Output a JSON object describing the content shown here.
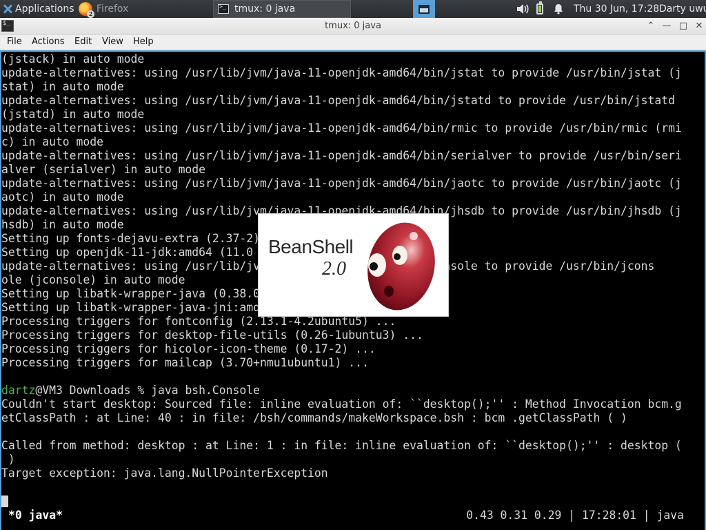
{
  "taskbar": {
    "apps_label": "Applications",
    "firefox_label": "Firefox",
    "firefox_badge": "2",
    "tmux_label": "tmux: 0 java",
    "clock": "Thu 30 Jun, 17:28",
    "user": "Darty uwu"
  },
  "window": {
    "title": "tmux: 0 java"
  },
  "menu": {
    "file": "File",
    "actions": "Actions",
    "edit": "Edit",
    "view": "View",
    "help": "Help"
  },
  "terminal": {
    "lines": [
      "(jstack) in auto mode",
      "update-alternatives: using /usr/lib/jvm/java-11-openjdk-amd64/bin/jstat to provide /usr/bin/jstat (j",
      "stat) in auto mode",
      "update-alternatives: using /usr/lib/jvm/java-11-openjdk-amd64/bin/jstatd to provide /usr/bin/jstatd",
      "(jstatd) in auto mode",
      "update-alternatives: using /usr/lib/jvm/java-11-openjdk-amd64/bin/rmic to provide /usr/bin/rmic (rmi",
      "c) in auto mode",
      "update-alternatives: using /usr/lib/jvm/java-11-openjdk-amd64/bin/serialver to provide /usr/bin/seri",
      "alver (serialver) in auto mode",
      "update-alternatives: using /usr/lib/jvm/java-11-openjdk-amd64/bin/jaotc to provide /usr/bin/jaotc (j",
      "aotc) in auto mode",
      "update-alternatives: using /usr/lib/jvm/java-11-openjdk-amd64/bin/jhsdb to provide /usr/bin/jhsdb (j",
      "hsdb) in auto mode",
      "Setting up fonts-dejavu-extra (2.37-2)",
      "Setting up openjdk-11-jdk:amd64 (11.0",
      "update-alternatives: using /usr/lib/jv                       /jconsole to provide /usr/bin/jcons",
      "ole (jconsole) in auto mode",
      "Setting up libatk-wrapper-java (0.38.0",
      "Setting up libatk-wrapper-java-jni:amd",
      "Processing triggers for fontconfig (2.13.1-4.2ubuntu5) ...",
      "Processing triggers for desktop-file-utils (0.26-1ubuntu3) ...",
      "Processing triggers for hicolor-icon-theme (0.17-2) ...",
      "Processing triggers for mailcap (3.70+nmu1ubuntu1) ...",
      "",
      "",
      "Couldn't start desktop: Sourced file: inline evaluation of: ``desktop();'' : Method Invocation bcm.g",
      "etClassPath : at Line: 40 : in file: /bsh/commands/makeWorkspace.bsh : bcm .getClassPath ( )",
      "",
      "Called from method: desktop : at Line: 1 : in file: inline evaluation of: ``desktop();'' : desktop (",
      " )",
      "Target exception: java.lang.NullPointerException",
      ""
    ],
    "prompt_user": "dartz",
    "prompt_rest": "@VM3 Downloads % java bsh.Console",
    "status_left": "*0 java*",
    "status_right": "0.43 0.31 0.29 | 17:28:01 | java"
  },
  "splash": {
    "title": "BeanShell",
    "version": "2.0"
  },
  "colors": {
    "prompt_user": "#4caf50",
    "accent": "#5a9fd6",
    "bean_red": "#a3182a"
  }
}
